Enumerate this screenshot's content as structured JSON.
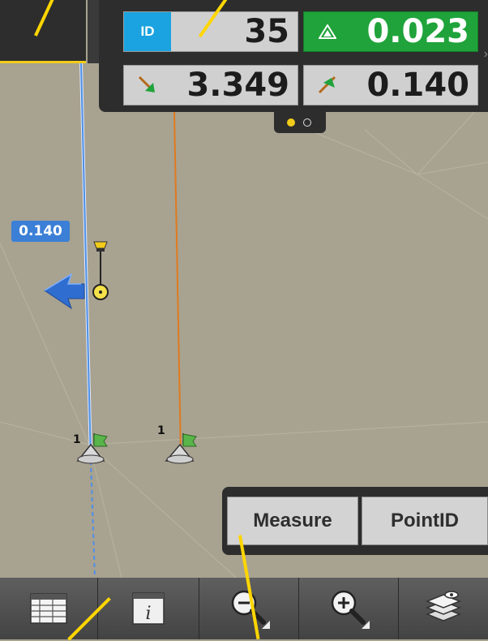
{
  "hud": {
    "id_label": "ID",
    "id_value": "35",
    "delta_value": "0.023",
    "offset_along_value": "3.349",
    "offset_cross_value": "0.140",
    "page_dots": [
      "active",
      "inactive"
    ]
  },
  "map": {
    "distance_badge": "0.140",
    "point_a_label": "1",
    "point_b_label": "1"
  },
  "buttons": {
    "measure_label": "Measure",
    "pointid_label": "PointID"
  },
  "toolbar": {
    "items": [
      "table-icon",
      "info-icon",
      "zoom-out-icon",
      "zoom-in-icon",
      "layers-icon"
    ]
  },
  "colors": {
    "panel": "#2d2d2d",
    "id_blue": "#1aa3e0",
    "delta_green": "#1fa33a",
    "accent_yellow": "#f2cc1a",
    "line_blue": "#4f8fe6",
    "line_orange": "#e07a1f",
    "map_bg": "#a8a290"
  }
}
